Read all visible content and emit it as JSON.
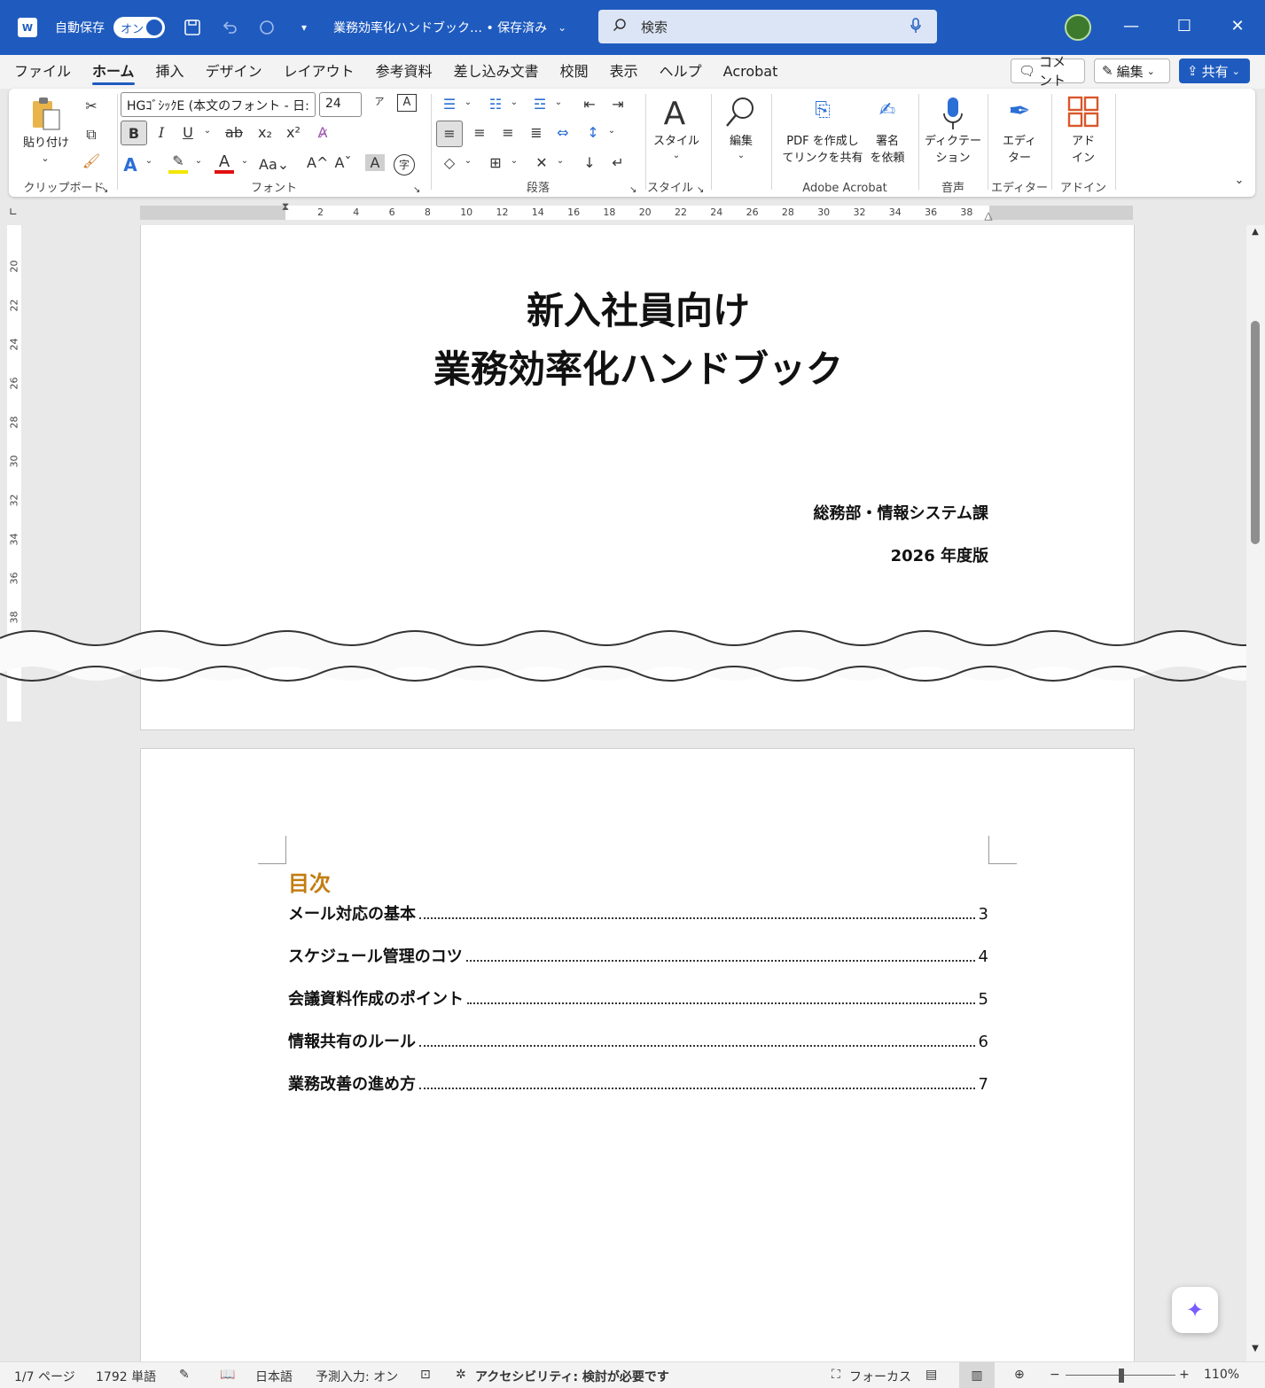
{
  "titlebar": {
    "app_icon": "W",
    "autosave_label": "自動保存",
    "autosave_state": "オン",
    "doc_title": "業務効率化ハンドブック… • 保存済み",
    "search_placeholder": "検索",
    "minimize": "—",
    "maximize": "☐",
    "close": "✕"
  },
  "menu": {
    "tabs": [
      "ファイル",
      "ホーム",
      "挿入",
      "デザイン",
      "レイアウト",
      "参考資料",
      "差し込み文書",
      "校閲",
      "表示",
      "ヘルプ",
      "Acrobat"
    ],
    "comment": "コメント",
    "edit": "編集",
    "share": "共有"
  },
  "ribbon": {
    "clipboard": {
      "paste": "貼り付け",
      "label": "クリップボード"
    },
    "font": {
      "font_name": "HGｺﾞｼｯｸE (本文のフォント - 日:",
      "font_size": "24",
      "label": "フォント"
    },
    "paragraph": {
      "label": "段落"
    },
    "styles": {
      "button": "スタイル",
      "label": "スタイル"
    },
    "editing": {
      "button": "編集"
    },
    "acrobat": {
      "pdf_share": "PDF を作成し\nてリンクを共有",
      "sign": "署名\nを依頼",
      "label": "Adobe Acrobat"
    },
    "voice": {
      "dictate": "ディクテー\nション",
      "label": "音声"
    },
    "editor": {
      "button": "エディ\nター",
      "label": "エディター"
    },
    "addins": {
      "button": "アド\nイン",
      "label": "アドイン"
    }
  },
  "ruler_numbers": [
    "2",
    "4",
    "6",
    "8",
    "10",
    "12",
    "14",
    "16",
    "18",
    "20",
    "22",
    "24",
    "26",
    "28",
    "30",
    "32",
    "34",
    "36",
    "38"
  ],
  "vruler_numbers": [
    "20",
    "22",
    "24",
    "26",
    "28",
    "30",
    "32",
    "34",
    "36",
    "38"
  ],
  "document": {
    "title_line1": "新入社員向け",
    "title_line2": "業務効率化ハンドブック",
    "department": "総務部・情報システム課",
    "edition": "2026 年度版",
    "toc_heading": "目次",
    "toc": [
      {
        "title": "メール対応の基本",
        "page": "3"
      },
      {
        "title": "スケジュール管理のコツ",
        "page": "4"
      },
      {
        "title": "会議資料作成のポイント",
        "page": "5"
      },
      {
        "title": "情報共有のルール",
        "page": "6"
      },
      {
        "title": "業務改善の進め方",
        "page": "7"
      }
    ]
  },
  "status": {
    "page": "1/7 ページ",
    "words": "1792 単語",
    "language": "日本語",
    "predictive": "予測入力: オン",
    "accessibility": "アクセシビリティ: 検討が必要です",
    "focus": "フォーカス",
    "zoom": "110%"
  },
  "colors": {
    "brand": "#1f5bbf",
    "toc_heading": "#c37d10"
  }
}
